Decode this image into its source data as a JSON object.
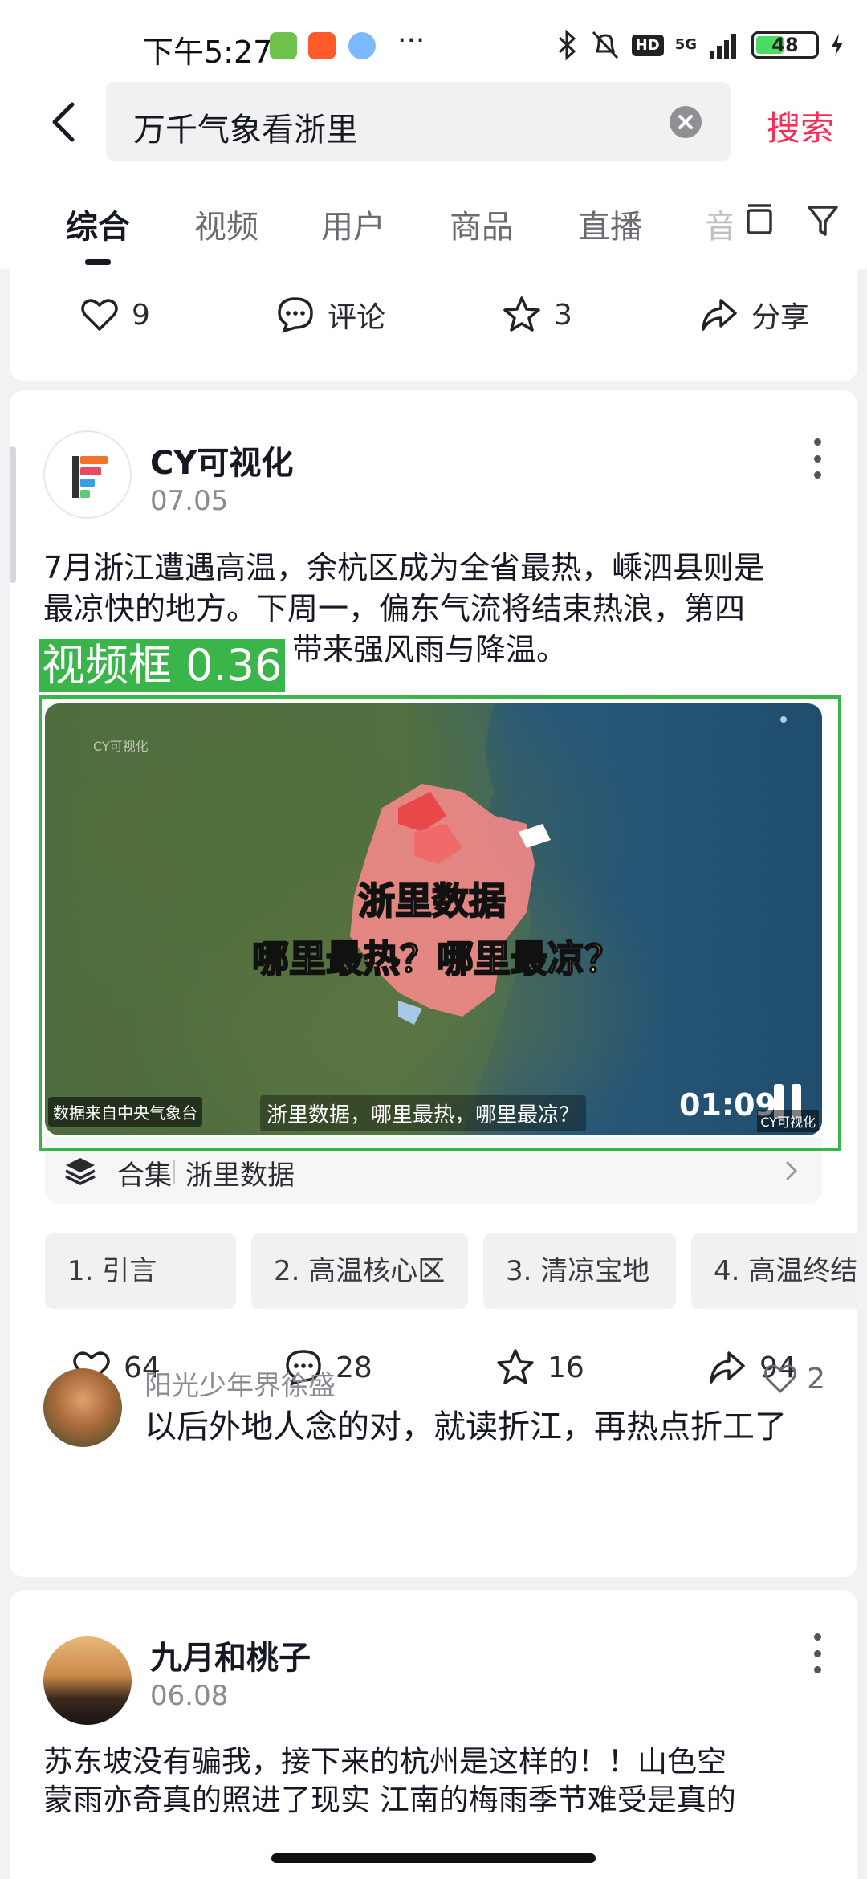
{
  "status_bar": {
    "time": "下午5:27",
    "network": "5G",
    "battery": "48",
    "battery_level_pct": 48
  },
  "search": {
    "query": "万千气象看浙里",
    "search_label": "搜索"
  },
  "tabs": [
    {
      "label": "综合",
      "active": true
    },
    {
      "label": "视频"
    },
    {
      "label": "用户"
    },
    {
      "label": "商品"
    },
    {
      "label": "直播"
    },
    {
      "label": "音"
    }
  ],
  "prev_card": {
    "likes": "9",
    "comment_label": "评论",
    "favorites": "3",
    "share_label": "分享"
  },
  "post1": {
    "author": "CY可视化",
    "date": "07.05",
    "text_lines": [
      "7月浙江遭遇高温，余杭区成为全省最热，嵊泗县则是",
      "最凉快的地方。下周一，偏东气流将结束热浪，第四",
      "带来强风雨与降温。"
    ],
    "detection_label": "视频框 0.36",
    "video": {
      "watermark_top": "CY可视化",
      "title_line1": "浙里数据",
      "title_line2": "哪里最热？哪里最凉？",
      "source": "数据来自中央气象台",
      "subtitle": "浙里数据，哪里最热，哪里最凉？",
      "duration": "01:09",
      "watermark": "CY可视化"
    },
    "collection": {
      "label": "合集",
      "name": "浙里数据"
    },
    "chapters": [
      "1. 引言",
      "2. 高温核心区",
      "3. 清凉宝地",
      "4. 高温终结"
    ],
    "likes": "64",
    "comments": "28",
    "favorites": "16",
    "shares": "94",
    "top_comment": {
      "user": "阳光少年界徐盛",
      "text": "以后外地人念的对，就读折江，再热点折工了",
      "likes": "2"
    }
  },
  "post2": {
    "author": "九月和桃子",
    "date": "06.08",
    "text_lines": [
      "苏东坡没有骗我，接下来的杭州是这样的！！山色空",
      "蒙雨亦奇真的照进了现实 江南的梅雨季节难受是真的"
    ]
  },
  "colors": {
    "accent": "#fe2c55",
    "detection": "#39b54a",
    "highlight_text": "#ffe74d"
  }
}
